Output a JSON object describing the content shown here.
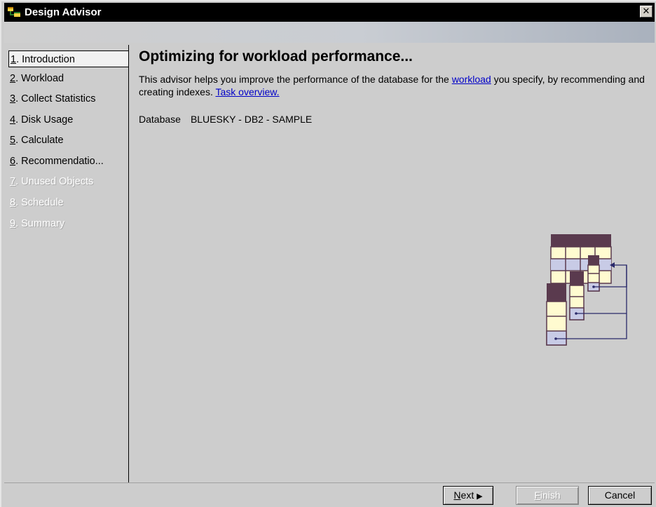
{
  "window": {
    "title": "Design Advisor",
    "close_glyph": "✕"
  },
  "sidebar": {
    "items": [
      {
        "mnemonic": "1",
        "label": ". Introduction",
        "state": "selected"
      },
      {
        "mnemonic": "2",
        "label": ". Workload",
        "state": "enabled"
      },
      {
        "mnemonic": "3",
        "label": ". Collect Statistics",
        "state": "enabled"
      },
      {
        "mnemonic": "4",
        "label": ". Disk Usage",
        "state": "enabled"
      },
      {
        "mnemonic": "5",
        "label": ". Calculate",
        "state": "enabled"
      },
      {
        "mnemonic": "6",
        "label": ". Recommendatio...",
        "state": "enabled"
      },
      {
        "mnemonic": "7",
        "label": ". Unused Objects",
        "state": "disabled"
      },
      {
        "mnemonic": "8",
        "label": ". Schedule",
        "state": "disabled"
      },
      {
        "mnemonic": "9",
        "label": ". Summary",
        "state": "disabled"
      }
    ]
  },
  "main": {
    "heading": "Optimizing for workload performance...",
    "desc_part1": "This advisor helps you improve the performance of the database for the ",
    "desc_link1": "workload",
    "desc_part2": " you specify, by recommending and creating indexes. ",
    "desc_link2": "Task overview.",
    "database_label": "Database",
    "database_value": "BLUESKY - DB2 - SAMPLE",
    "illustration": "table-index-illustration"
  },
  "footer": {
    "next": {
      "mnemonic": "N",
      "label": "ext",
      "arrow": "▶"
    },
    "finish": {
      "mnemonic": "F",
      "label": "inish"
    },
    "cancel": {
      "label": "Cancel"
    }
  },
  "colors": {
    "titlebar": "#000000",
    "window_bg": "#cdcdcd",
    "link": "#0000c8",
    "illustration_header": "#5a3a4e",
    "illustration_cell": "#fffbd0",
    "illustration_row": "#c8cbe6",
    "illustration_line": "#2a2a6a"
  }
}
